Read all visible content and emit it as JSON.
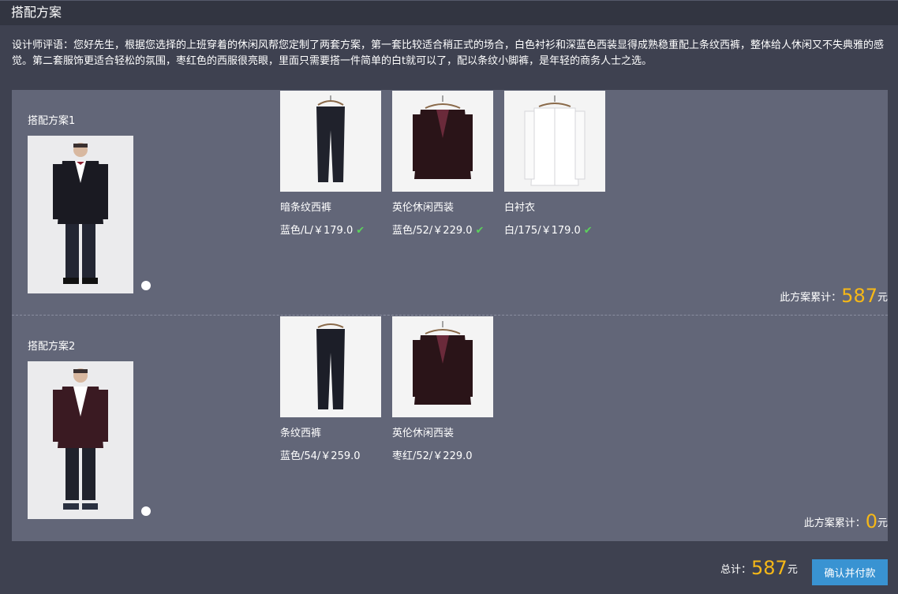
{
  "header": {
    "title": "搭配方案"
  },
  "comment": "设计师评语：您好先生，根据您选择的上班穿着的休闲风帮您定制了两套方案，第一套比较适合稍正式的场合，白色衬衫和深蓝色西装显得成熟稳重配上条纹西裤，整体给人休闲又不失典雅的感觉。第二套服饰更适合轻松的氛围，枣红色的西服很亮眼，里面只需要搭一件简单的白t就可以了，配以条纹小脚裤，是年轻的商务人士之选。",
  "schemes": [
    {
      "label": "搭配方案1",
      "items": [
        {
          "name": "暗条纹西裤",
          "spec": "蓝色/L/￥179.0",
          "checked": true
        },
        {
          "name": "英伦休闲西装",
          "spec": "蓝色/52/￥229.0",
          "checked": true
        },
        {
          "name": "白衬衣",
          "spec": "白/175/￥179.0",
          "checked": true
        }
      ],
      "subtotal_label": "此方案累计：",
      "subtotal_value": "587",
      "unit": "元"
    },
    {
      "label": "搭配方案2",
      "items": [
        {
          "name": "条纹西裤",
          "spec": "蓝色/54/￥259.0",
          "checked": false
        },
        {
          "name": "英伦休闲西装",
          "spec": "枣红/52/￥229.0",
          "checked": false
        }
      ],
      "subtotal_label": "此方案累计：",
      "subtotal_value": "0",
      "unit": "元"
    }
  ],
  "footer": {
    "total_label": "总计：",
    "total_value": "587",
    "unit": "元",
    "pay_button": "确认并付款"
  },
  "colors": {
    "accent": "#f6b817",
    "check": "#5bd25b",
    "button": "#3993d2",
    "panel": "#626678"
  },
  "icons": {
    "check": "check-icon"
  }
}
